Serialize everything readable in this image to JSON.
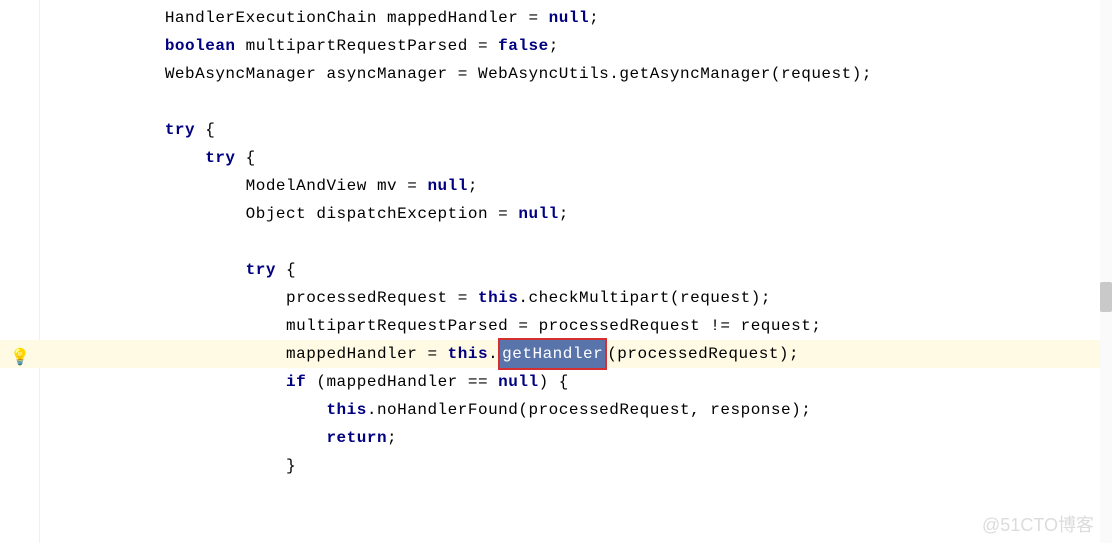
{
  "code": {
    "lines": [
      {
        "indent": "        ",
        "tokens": [
          {
            "t": "HandlerExecutionChain mappedHandler = ",
            "k": "norm"
          },
          {
            "t": "null",
            "k": "kw"
          },
          {
            "t": ";",
            "k": "norm"
          }
        ]
      },
      {
        "indent": "        ",
        "tokens": [
          {
            "t": "boolean ",
            "k": "kw"
          },
          {
            "t": "multipartRequestParsed = ",
            "k": "norm"
          },
          {
            "t": "false",
            "k": "kw"
          },
          {
            "t": ";",
            "k": "norm"
          }
        ]
      },
      {
        "indent": "        ",
        "tokens": [
          {
            "t": "WebAsyncManager asyncManager = WebAsyncUtils.getAsyncManager(request);",
            "k": "norm"
          }
        ]
      },
      {
        "indent": "",
        "tokens": []
      },
      {
        "indent": "        ",
        "tokens": [
          {
            "t": "try ",
            "k": "kw"
          },
          {
            "t": "{",
            "k": "norm"
          }
        ]
      },
      {
        "indent": "            ",
        "tokens": [
          {
            "t": "try ",
            "k": "kw"
          },
          {
            "t": "{",
            "k": "norm"
          }
        ]
      },
      {
        "indent": "                ",
        "tokens": [
          {
            "t": "ModelAndView mv = ",
            "k": "norm"
          },
          {
            "t": "null",
            "k": "kw"
          },
          {
            "t": ";",
            "k": "norm"
          }
        ]
      },
      {
        "indent": "                ",
        "tokens": [
          {
            "t": "Object dispatchException = ",
            "k": "norm"
          },
          {
            "t": "null",
            "k": "kw"
          },
          {
            "t": ";",
            "k": "norm"
          }
        ]
      },
      {
        "indent": "",
        "tokens": []
      },
      {
        "indent": "                ",
        "tokens": [
          {
            "t": "try ",
            "k": "kw"
          },
          {
            "t": "{",
            "k": "norm"
          }
        ]
      },
      {
        "indent": "                    ",
        "tokens": [
          {
            "t": "processedRequest = ",
            "k": "norm"
          },
          {
            "t": "this",
            "k": "kw"
          },
          {
            "t": ".checkMultipart(request);",
            "k": "norm"
          }
        ]
      },
      {
        "indent": "                    ",
        "tokens": [
          {
            "t": "multipartRequestParsed = processedRequest != request;",
            "k": "norm"
          }
        ]
      },
      {
        "indent": "                    ",
        "tokens": [
          {
            "t": "mappedHandler = ",
            "k": "norm"
          },
          {
            "t": "this",
            "k": "kw"
          },
          {
            "t": ".",
            "k": "norm"
          },
          {
            "t": "getHandler",
            "k": "sel"
          },
          {
            "t": "(processedRequest);",
            "k": "norm"
          }
        ],
        "highlight": true,
        "bulb": true
      },
      {
        "indent": "                    ",
        "tokens": [
          {
            "t": "if ",
            "k": "kw"
          },
          {
            "t": "(mappedHandler == ",
            "k": "norm"
          },
          {
            "t": "null",
            "k": "kw"
          },
          {
            "t": ") {",
            "k": "norm"
          }
        ]
      },
      {
        "indent": "                        ",
        "tokens": [
          {
            "t": "this",
            "k": "kw"
          },
          {
            "t": ".noHandlerFound(processedRequest, response);",
            "k": "norm"
          }
        ]
      },
      {
        "indent": "                        ",
        "tokens": [
          {
            "t": "return",
            "k": "kw"
          },
          {
            "t": ";",
            "k": "norm"
          }
        ]
      },
      {
        "indent": "                    ",
        "tokens": [
          {
            "t": "}",
            "k": "norm"
          }
        ]
      }
    ]
  },
  "watermark": "@51CTO博客",
  "bulb_glyph": "💡"
}
